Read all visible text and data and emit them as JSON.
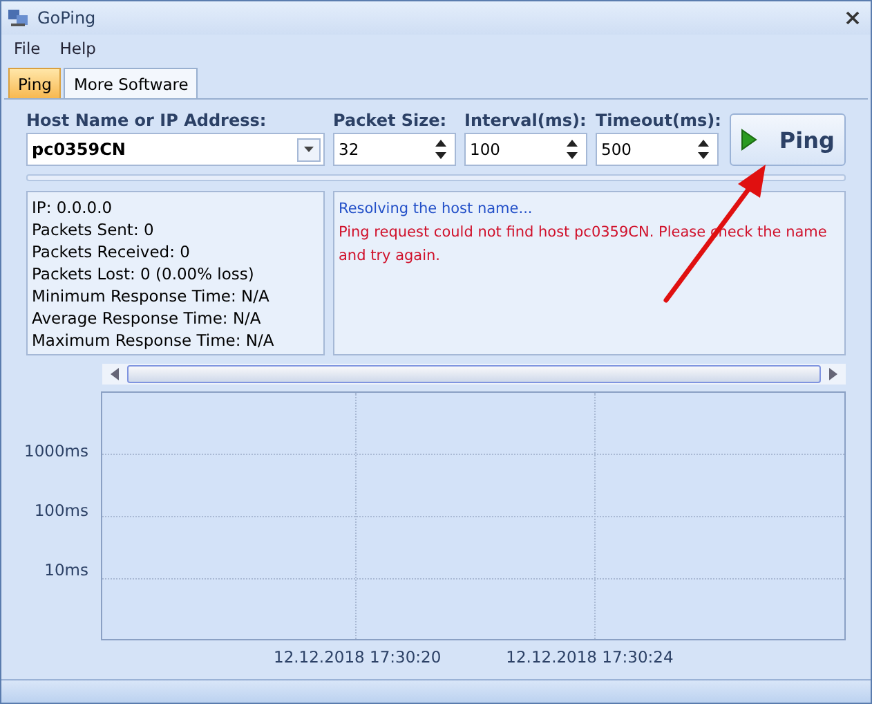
{
  "window": {
    "title": "GoPing"
  },
  "menu": [
    "File",
    "Help"
  ],
  "tabs": [
    {
      "label": "Ping",
      "selected": true
    },
    {
      "label": "More Software",
      "selected": false
    }
  ],
  "host": {
    "label": "Host Name or IP Address:",
    "value": "pc0359CN"
  },
  "spinners": [
    {
      "label": "Packet Size:",
      "value": "32"
    },
    {
      "label": "Interval(ms):",
      "value": "100"
    },
    {
      "label": "Timeout(ms):",
      "value": "500"
    }
  ],
  "ping_button": "Ping",
  "stats": [
    "IP: 0.0.0.0",
    "Packets Sent: 0",
    "Packets Received: 0",
    "Packets Lost: 0 (0.00% loss)",
    "Minimum Response Time: N/A",
    "Average Response Time: N/A",
    "Maximum Response Time: N/A"
  ],
  "log": [
    {
      "kind": "info",
      "text": "Resolving the host name..."
    },
    {
      "kind": "error",
      "text": "Ping request could not find host pc0359CN. Please check the name and try again."
    }
  ],
  "graph": {
    "y_labels": [
      "1000ms",
      "100ms",
      "10ms"
    ],
    "x_labels": [
      "12.12.2018 17:30:20",
      "12.12.2018 17:30:24"
    ]
  }
}
